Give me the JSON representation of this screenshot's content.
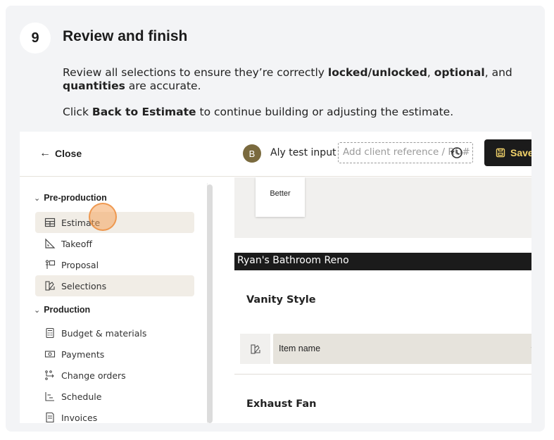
{
  "step": {
    "number": "9",
    "title": "Review and finish",
    "p1": {
      "a": "Review all selections to ensure they’re correctly ",
      "b": "locked/unlocked",
      "c": ", ",
      "d": "optional",
      "e": ", and ",
      "f": "quantities",
      "g": " are accurate."
    },
    "p2": {
      "a": "Click ",
      "b": "Back to Estimate",
      "c": " to continue building or adjusting the estimate."
    }
  },
  "topbar": {
    "close_label": "Close",
    "avatar_initial": "B",
    "project_name": "Aly test input",
    "reference_placeholder": "Add client reference / RO#",
    "save_label": "Save e"
  },
  "sidebar": {
    "groups": [
      {
        "label": "Pre-production",
        "items": [
          {
            "label": "Estimate",
            "icon": "table-icon"
          },
          {
            "label": "Takeoff",
            "icon": "ruler-icon"
          },
          {
            "label": "Proposal",
            "icon": "easel-icon"
          },
          {
            "label": "Selections",
            "icon": "swatch-icon"
          }
        ]
      },
      {
        "label": "Production",
        "items": [
          {
            "label": "Budget & materials",
            "icon": "calculator-icon"
          },
          {
            "label": "Payments",
            "icon": "cash-icon"
          },
          {
            "label": "Change orders",
            "icon": "flow-icon"
          },
          {
            "label": "Schedule",
            "icon": "gantt-icon"
          },
          {
            "label": "Invoices",
            "icon": "invoice-icon"
          }
        ]
      }
    ]
  },
  "main": {
    "tier_label": "Better",
    "section_title": "Ryan's Bathroom Reno",
    "items": [
      {
        "title": "Vanity Style",
        "select_placeholder": "Item name"
      },
      {
        "title": "Exhaust Fan"
      }
    ]
  },
  "colors": {
    "accent": "#f3d36a",
    "dark": "#1b1b1b",
    "active_bg": "#f1ede6",
    "select_bg": "#e6e3dc",
    "click_indicator": "#f4a45c"
  }
}
